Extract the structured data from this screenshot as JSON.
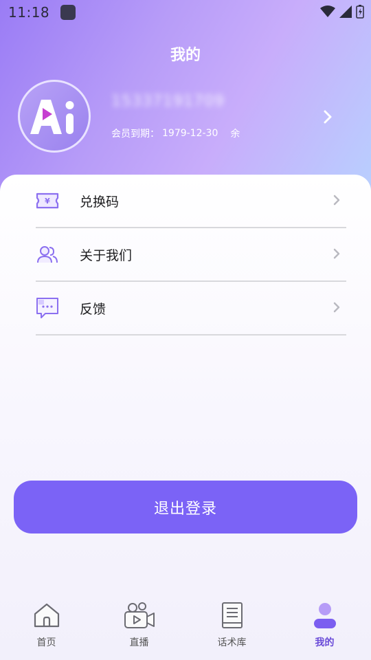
{
  "status": {
    "time": "11:18"
  },
  "page": {
    "title": "我的"
  },
  "profile": {
    "phone": "15337191709",
    "member_label": "会员到期：",
    "member_date": "1979-12-30",
    "remaining_label": "余"
  },
  "menu": [
    {
      "label": "兑换码",
      "icon": "voucher-icon"
    },
    {
      "label": "关于我们",
      "icon": "users-icon"
    },
    {
      "label": "反馈",
      "icon": "feedback-icon"
    }
  ],
  "logout": {
    "label": "退出登录"
  },
  "tabs": [
    {
      "label": "首页",
      "icon": "home-icon",
      "active": false
    },
    {
      "label": "直播",
      "icon": "video-camera-icon",
      "active": false
    },
    {
      "label": "话术库",
      "icon": "book-icon",
      "active": false
    },
    {
      "label": "我的",
      "icon": "profile-icon",
      "active": true
    }
  ],
  "colors": {
    "accent": "#7b63f6",
    "active_tab": "#6a4bd8"
  }
}
